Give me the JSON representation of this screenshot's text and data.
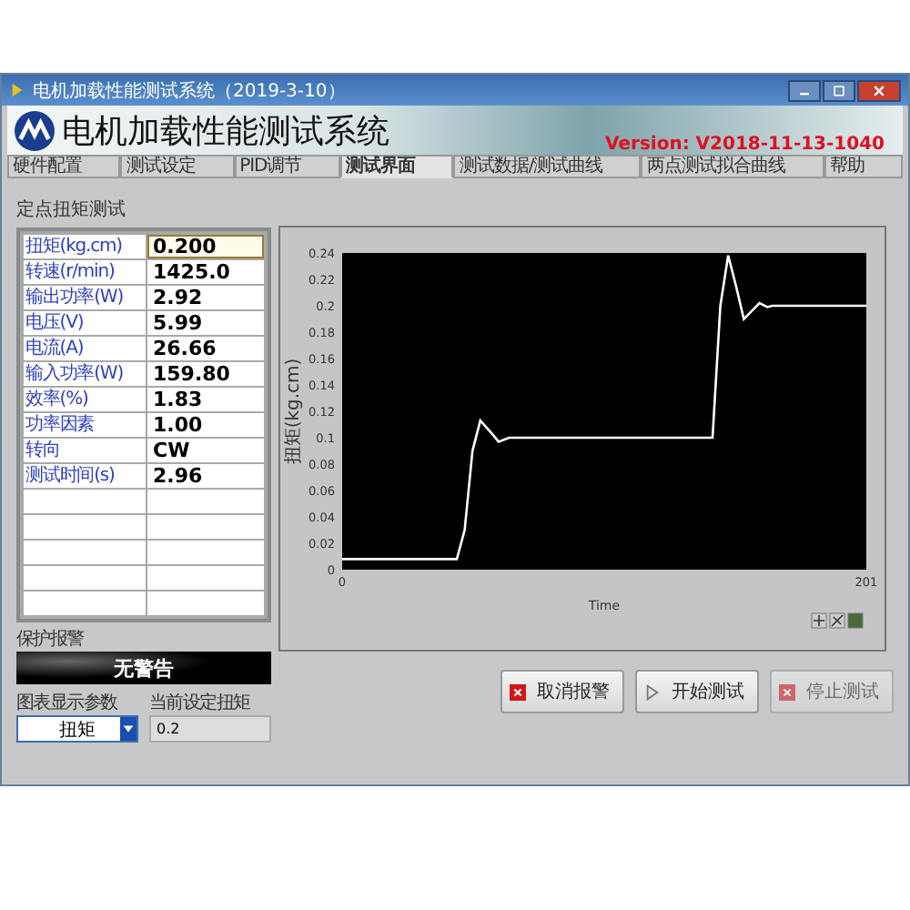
{
  "window": {
    "title": "电机加载性能测试系统（2019-3-10）"
  },
  "header": {
    "app_name": "电机加载性能测试系统",
    "version": "Version: V2018-11-13-1040"
  },
  "tabs": [
    {
      "label": "硬件配置",
      "selected": false
    },
    {
      "label": "测试设定",
      "selected": false
    },
    {
      "label": "PID调节",
      "selected": false
    },
    {
      "label": "测试界面",
      "selected": true
    },
    {
      "label": "测试数据/测试曲线",
      "selected": false
    },
    {
      "label": "两点测试拟合曲线",
      "selected": false
    },
    {
      "label": "帮助",
      "selected": false
    }
  ],
  "test_panel": {
    "title": "定点扭矩测试",
    "rows": [
      {
        "label": "扭矩(kg.cm)",
        "value": "0.200",
        "selected": true
      },
      {
        "label": "转速(r/min)",
        "value": "1425.0",
        "selected": false
      },
      {
        "label": "输出功率(W)",
        "value": "2.92",
        "selected": false
      },
      {
        "label": "电压(V)",
        "value": "5.99",
        "selected": false
      },
      {
        "label": "电流(A)",
        "value": "26.66",
        "selected": false
      },
      {
        "label": "输入功率(W)",
        "value": "159.80",
        "selected": false
      },
      {
        "label": "效率(%)",
        "value": "1.83",
        "selected": false
      },
      {
        "label": "功率因素",
        "value": "1.00",
        "selected": false
      },
      {
        "label": "转向",
        "value": "CW",
        "selected": false
      },
      {
        "label": "测试时间(s)",
        "value": "2.96",
        "selected": false
      }
    ]
  },
  "alarm": {
    "label": "保护报警",
    "status": "无警告"
  },
  "chart_param": {
    "label": "图表显示参数",
    "value": "扭矩"
  },
  "torque_setting": {
    "label": "当前设定扭矩",
    "value": "0.2"
  },
  "chart": {
    "chart_data": {
      "type": "line",
      "xlabel": "Time",
      "ylabel": "扭矩(kg.cm)",
      "xlim": [
        0,
        201
      ],
      "ylim": [
        0,
        0.24
      ],
      "xticks": [
        0,
        201
      ],
      "yticks": [
        0,
        0.02,
        0.04,
        0.06,
        0.08,
        0.1,
        0.12,
        0.14,
        0.16,
        0.18,
        0.2,
        0.22,
        0.24
      ],
      "x": [
        0,
        44,
        47,
        50,
        53,
        57,
        60,
        64,
        100,
        142,
        145,
        148,
        151,
        154,
        157,
        160,
        163,
        165,
        201
      ],
      "series": [
        {
          "color": "#ffffff",
          "values": [
            0.008,
            0.008,
            0.03,
            0.09,
            0.113,
            0.104,
            0.097,
            0.1,
            0.1,
            0.1,
            0.2,
            0.238,
            0.215,
            0.19,
            0.196,
            0.202,
            0.199,
            0.2,
            0.2
          ]
        }
      ]
    }
  },
  "buttons": [
    {
      "label": "取消报警",
      "kind": "cancel",
      "disabled": false
    },
    {
      "label": "开始测试",
      "kind": "start",
      "disabled": false
    },
    {
      "label": "停止测试",
      "kind": "cancel",
      "disabled": true
    }
  ]
}
